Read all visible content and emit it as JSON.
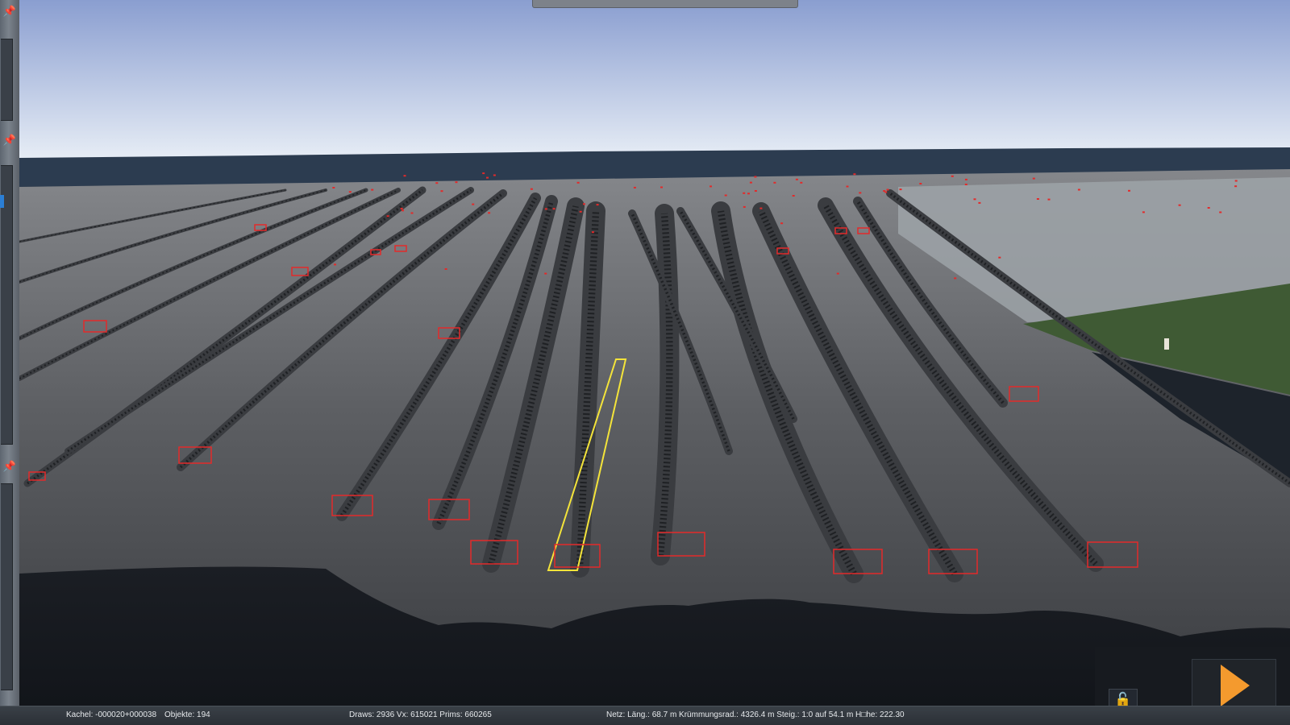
{
  "toolbar": {
    "pin_icon_glyph": "📌",
    "lock_icon_glyph": "🔓"
  },
  "colors": {
    "track": "#3a3c40",
    "track_selected": "#f4e43a",
    "markers": "#e32a2a",
    "sky_top": "#8a9ed0",
    "sky_bottom": "#e8eef6",
    "play_button": "#f49a2e"
  },
  "statusbar": {
    "tile": "Kachel: -000020+000038",
    "objects": "Objekte: 194",
    "draws": "Draws: 2936 Vx: 615021 Prims: 660265",
    "network": "Netz:  Läng.:    68.7 m Krümmungsrad.: 4326.4 m Steig.: 1:0 auf 54.1 m H□he: 222.30"
  }
}
